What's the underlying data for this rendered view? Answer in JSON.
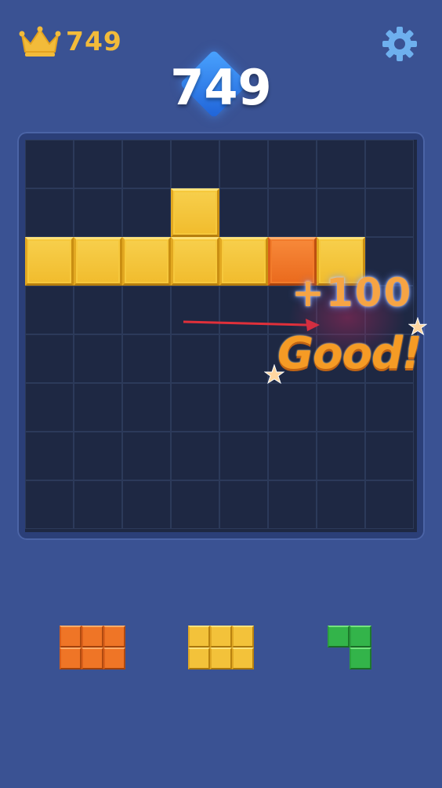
{
  "header": {
    "best_score": "749",
    "current_score": "749",
    "best_icon": "crown-icon",
    "settings_icon": "gear-icon"
  },
  "board": {
    "rows": 8,
    "cols": 8,
    "cells": [
      [
        "",
        "",
        "",
        "",
        "",
        "",
        "",
        ""
      ],
      [
        "",
        "",
        "",
        "yellow",
        "",
        "",
        "",
        ""
      ],
      [
        "yellow",
        "yellow",
        "yellow",
        "yellow",
        "yellow",
        "orange",
        "yellow",
        ""
      ],
      [
        "",
        "",
        "",
        "",
        "",
        "",
        "",
        ""
      ],
      [
        "",
        "",
        "",
        "",
        "",
        "",
        "",
        ""
      ],
      [
        "",
        "",
        "",
        "",
        "",
        "",
        "",
        ""
      ],
      [
        "",
        "",
        "",
        "",
        "",
        "",
        "",
        ""
      ],
      [
        "",
        "",
        "",
        "",
        "",
        "",
        "",
        ""
      ]
    ]
  },
  "feedback": {
    "points": "+100",
    "praise": "Good!"
  },
  "pieces": [
    {
      "color": "orange",
      "shape": [
        [
          1,
          1,
          1
        ],
        [
          1,
          1,
          1
        ]
      ]
    },
    {
      "color": "yellow",
      "shape": [
        [
          1,
          1,
          1
        ],
        [
          1,
          1,
          1
        ]
      ]
    },
    {
      "color": "green",
      "shape": [
        [
          1,
          1
        ],
        [
          0,
          1
        ]
      ]
    }
  ],
  "colors": {
    "background": "#3a5293",
    "board": "#1e2843",
    "yellow": "#f1bc2d",
    "orange": "#ea6a1d",
    "green": "#33b44a",
    "accent_gold": "#f2bb3a"
  }
}
